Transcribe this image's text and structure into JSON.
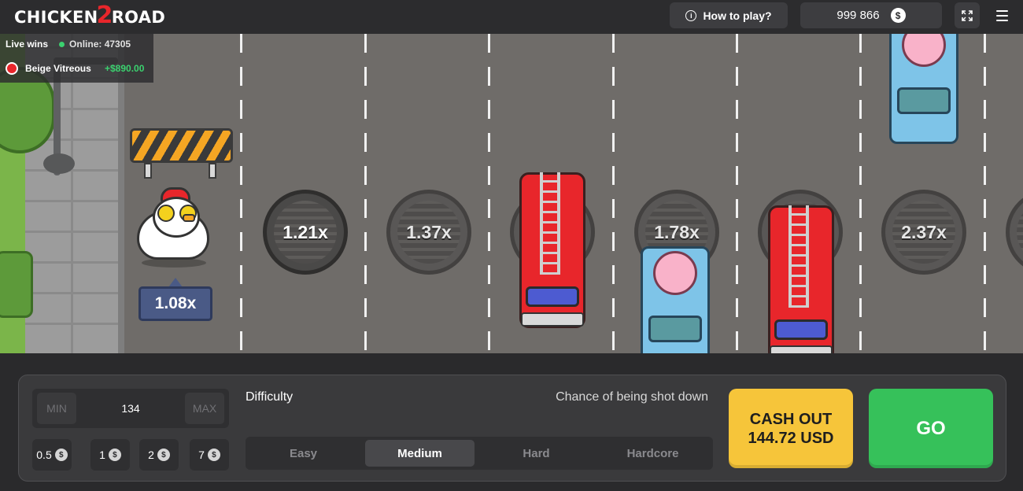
{
  "header": {
    "logo_word1": "CHICKEN",
    "logo_number": "2",
    "logo_word2": "ROAD",
    "howto_label": "How to play?",
    "info_glyph": "i",
    "balance": "999 866",
    "currency_glyph": "$",
    "fullscreen_icon": "expand-icon",
    "menu_icon": "hamburger-icon"
  },
  "live_wins": {
    "title": "Live wins",
    "online_label": "Online: 47305",
    "latest": {
      "name": "Beige Vitreous",
      "amount": "+$890.00"
    }
  },
  "game": {
    "current_multiplier": "1.08x",
    "multipliers": [
      "1.21x",
      "1.37x",
      "1.78x",
      "2.37x"
    ]
  },
  "controls": {
    "bet": {
      "min_label": "MIN",
      "max_label": "MAX",
      "value": "134"
    },
    "quick_bets": [
      {
        "value": "0.5",
        "glyph": "$"
      },
      {
        "value": "1",
        "glyph": "$"
      },
      {
        "value": "2",
        "glyph": "$"
      },
      {
        "value": "7",
        "glyph": "$"
      }
    ],
    "difficulty_label": "Difficulty",
    "chance_label": "Chance of being shot down",
    "difficulty_options": [
      "Easy",
      "Medium",
      "Hard",
      "Hardcore"
    ],
    "difficulty_selected": "Medium",
    "cashout_line1": "CASH OUT",
    "cashout_line2": "144.72 USD",
    "go_label": "GO"
  },
  "colors": {
    "cashout": "#f6c53a",
    "go": "#36c15a",
    "road": "#6f6c69",
    "online_dot": "#3bd16f"
  }
}
